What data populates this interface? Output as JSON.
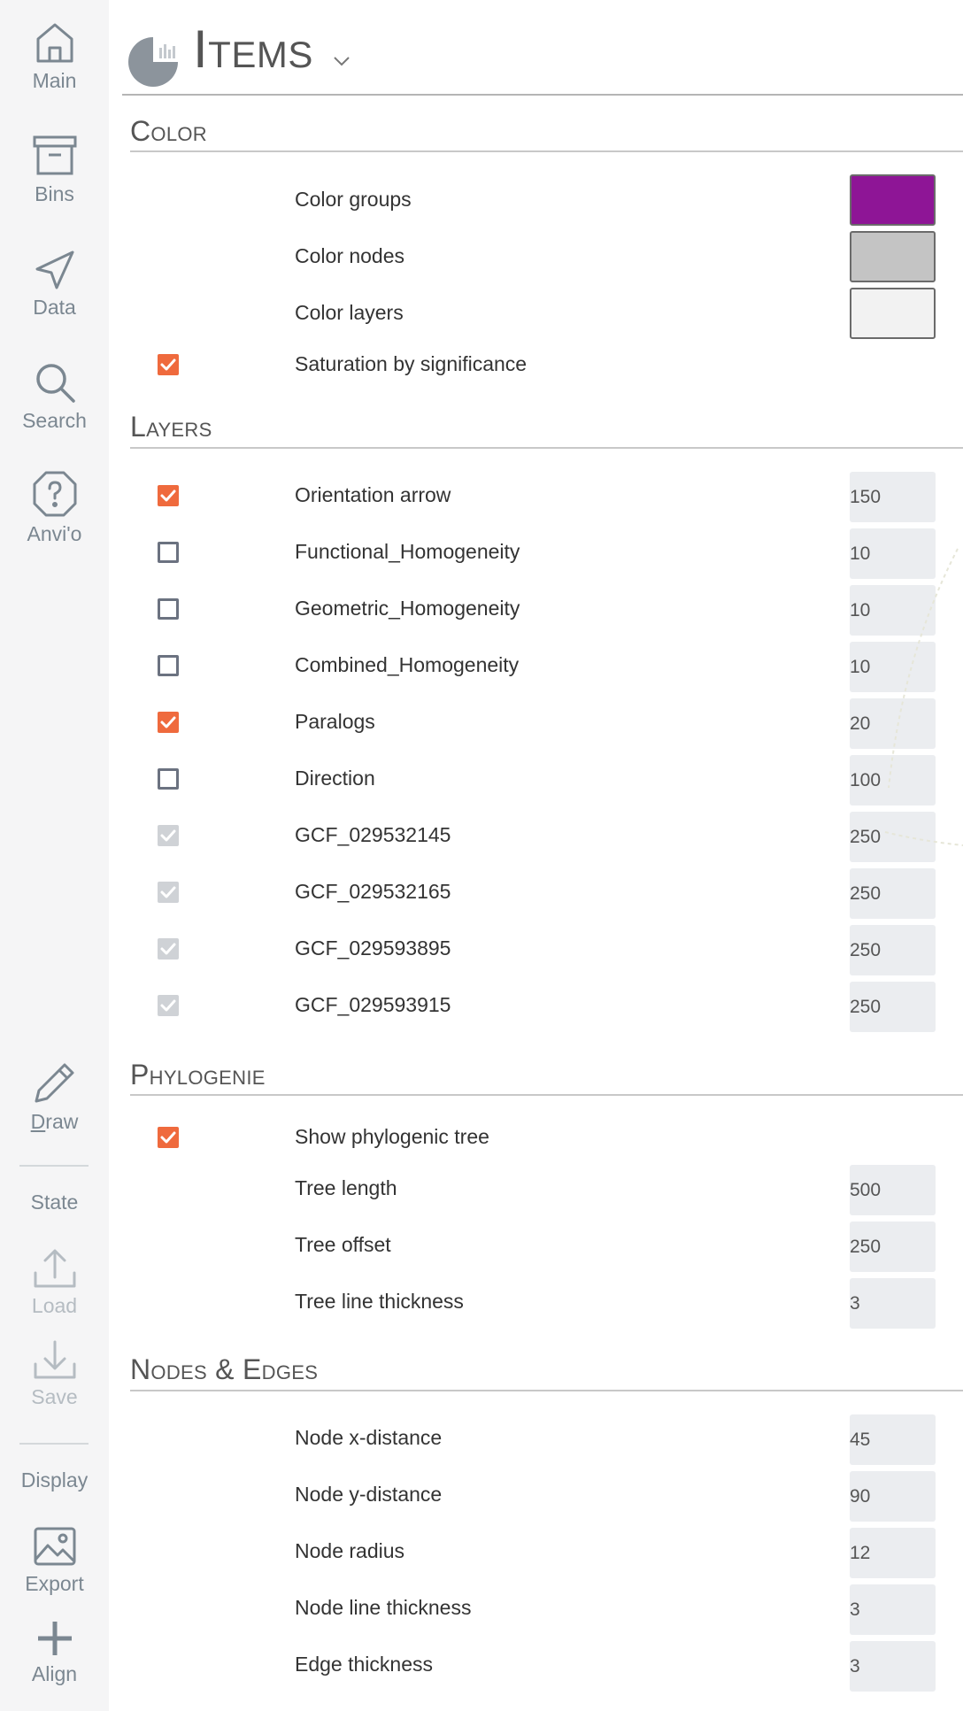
{
  "sidebar": {
    "main": "Main",
    "bins": "Bins",
    "data": "Data",
    "search": "Search",
    "anvio": "Anvi'o",
    "draw": "Draw",
    "state_heading": "State",
    "load": "Load",
    "save": "Save",
    "display_heading": "Display",
    "export": "Export",
    "align": "Align"
  },
  "panel": {
    "title": "Items"
  },
  "color": {
    "title": "Color",
    "groups": {
      "label": "Color groups",
      "color": "#8e1596"
    },
    "nodes": {
      "label": "Color nodes",
      "color": "#c4c4c4"
    },
    "layers": {
      "label": "Color layers",
      "color": "#f2f2f2"
    },
    "saturation": {
      "label": "Saturation by significance",
      "checked": true
    }
  },
  "layers": {
    "title": "Layers",
    "rows": [
      {
        "label": "Orientation arrow",
        "value": "150",
        "state": "on"
      },
      {
        "label": "Functional_Homogeneity",
        "value": "10",
        "state": "off"
      },
      {
        "label": "Geometric_Homogeneity",
        "value": "10",
        "state": "off"
      },
      {
        "label": "Combined_Homogeneity",
        "value": "10",
        "state": "off"
      },
      {
        "label": "Paralogs",
        "value": "20",
        "state": "on"
      },
      {
        "label": "Direction",
        "value": "100",
        "state": "off"
      },
      {
        "label": "GCF_029532145",
        "value": "250",
        "state": "disabled"
      },
      {
        "label": "GCF_029532165",
        "value": "250",
        "state": "disabled"
      },
      {
        "label": "GCF_029593895",
        "value": "250",
        "state": "disabled"
      },
      {
        "label": "GCF_029593915",
        "value": "250",
        "state": "disabled"
      }
    ]
  },
  "phylogenie": {
    "title": "Phylogenie",
    "show_tree": {
      "label": "Show phylogenic tree",
      "checked": true
    },
    "tree_length": {
      "label": "Tree length",
      "value": "500"
    },
    "tree_offset": {
      "label": "Tree offset",
      "value": "250"
    },
    "tree_line_thickness": {
      "label": "Tree line thickness",
      "value": "3"
    }
  },
  "nodes_edges": {
    "title": "Nodes & Edges",
    "node_x_distance": {
      "label": "Node x-distance",
      "value": "45"
    },
    "node_y_distance": {
      "label": "Node y-distance",
      "value": "90"
    },
    "node_radius": {
      "label": "Node radius",
      "value": "12"
    },
    "node_line_thickness": {
      "label": "Node line thickness",
      "value": "3"
    },
    "edge_thickness": {
      "label": "Edge thickness",
      "value": "3"
    }
  },
  "accent_color": "#ef6a3d"
}
